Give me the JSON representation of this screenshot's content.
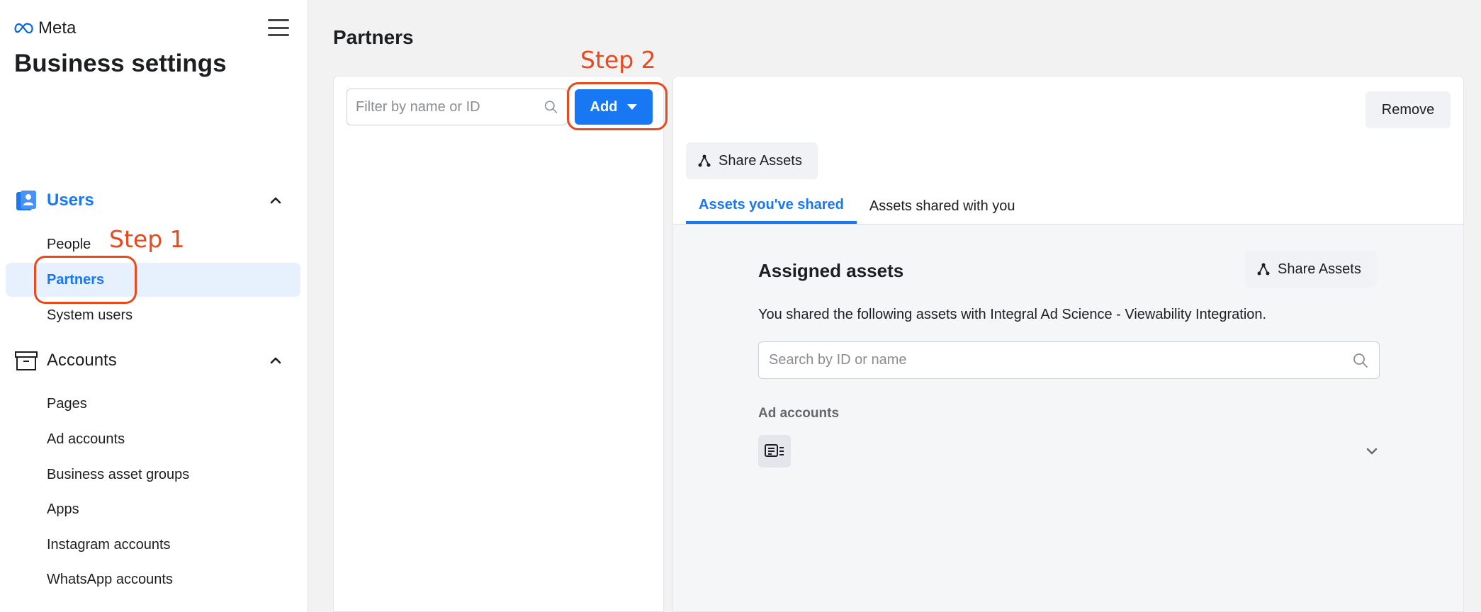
{
  "sidebar": {
    "logo_text": "Meta",
    "app_title": "Business settings",
    "users_section": {
      "label": "Users",
      "items": [
        "People",
        "Partners",
        "System users"
      ]
    },
    "accounts_section": {
      "label": "Accounts",
      "items": [
        "Pages",
        "Ad accounts",
        "Business asset groups",
        "Apps",
        "Instagram accounts",
        "WhatsApp accounts"
      ]
    }
  },
  "annotations": {
    "step1": "Step 1",
    "step2": "Step 2",
    "color": "#e8491d"
  },
  "main": {
    "page_title": "Partners",
    "filter_placeholder": "Filter by name or ID",
    "add_label": "Add",
    "remove_label": "Remove",
    "share_assets_label": "Share Assets",
    "tabs": [
      "Assets you've shared",
      "Assets shared with you"
    ],
    "assigned_title": "Assigned assets",
    "assigned_description": "You shared the following assets with Integral Ad Science - Viewability Integration.",
    "search_placeholder": "Search by ID or name",
    "ad_accounts_label": "Ad accounts"
  },
  "colors": {
    "accent": "#1877f2",
    "active_bg": "#e7f0fd"
  }
}
